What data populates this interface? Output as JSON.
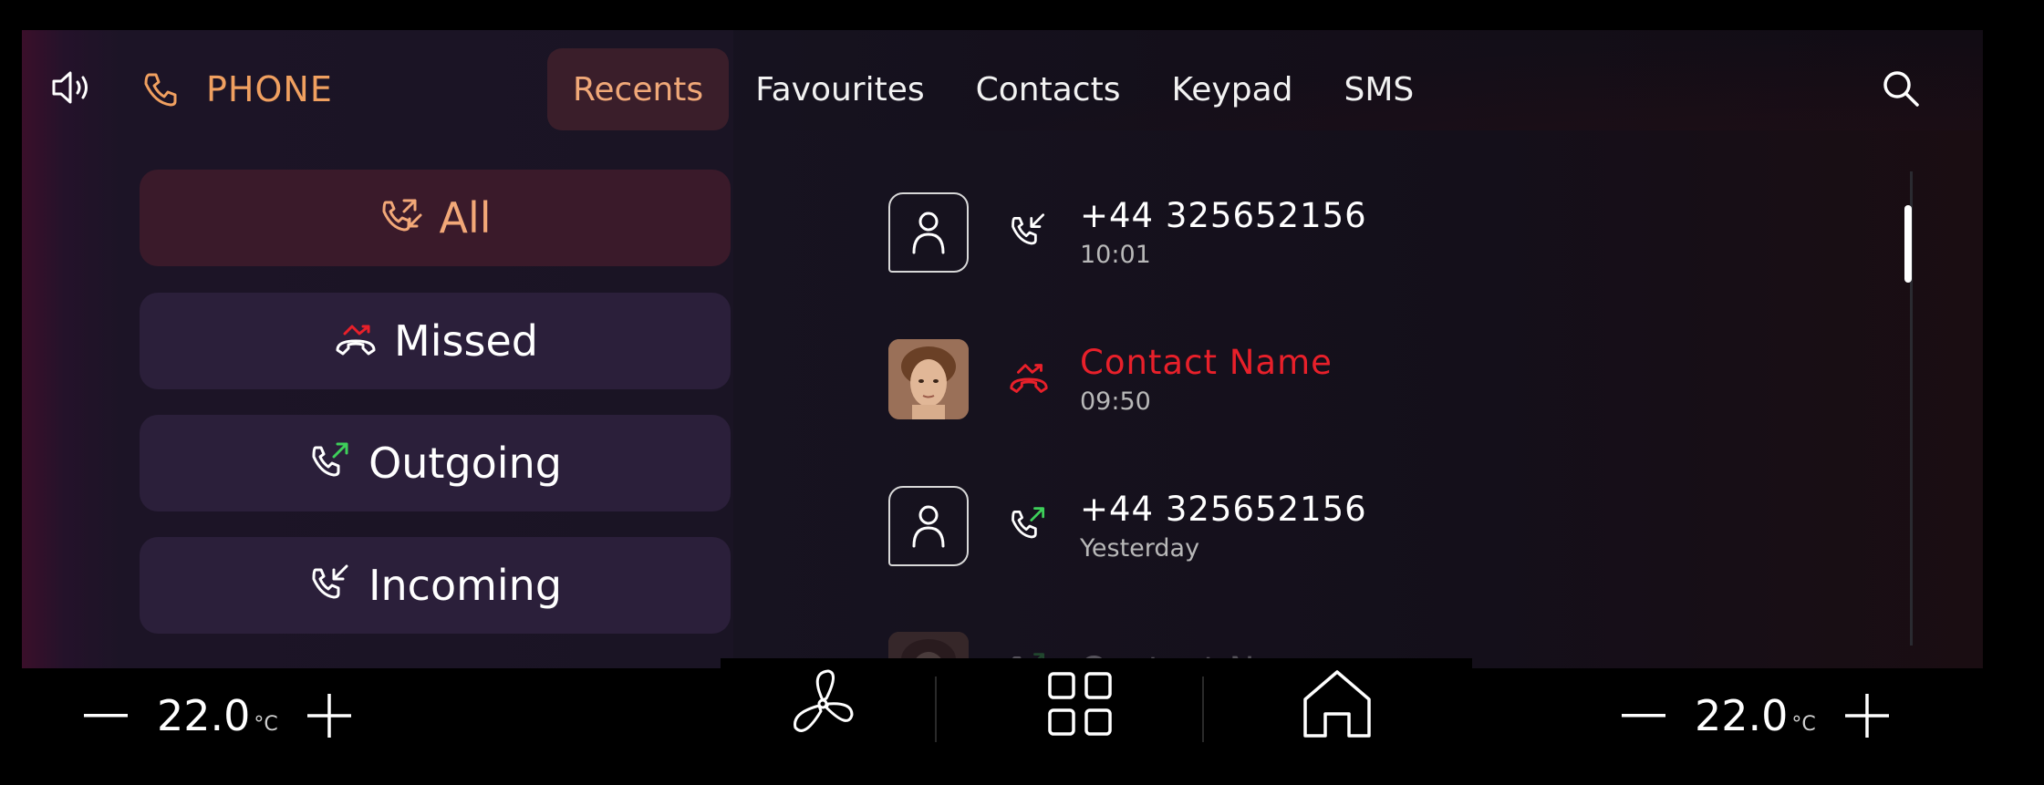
{
  "header": {
    "volume_icon": "speaker-icon",
    "app_icon": "phone-icon",
    "app_title": "PHONE",
    "tabs": [
      {
        "label": "Recents",
        "active": true
      },
      {
        "label": "Favourites",
        "active": false
      },
      {
        "label": "Contacts",
        "active": false
      },
      {
        "label": "Keypad",
        "active": false
      },
      {
        "label": "SMS",
        "active": false
      }
    ],
    "search_icon": "search-icon"
  },
  "filters": [
    {
      "label": "All",
      "icon": "all-calls-icon",
      "active": true
    },
    {
      "label": "Missed",
      "icon": "missed-call-icon",
      "active": false
    },
    {
      "label": "Outgoing",
      "icon": "outgoing-call-icon",
      "active": false
    },
    {
      "label": "Incoming",
      "icon": "incoming-call-icon",
      "active": false
    }
  ],
  "calls": [
    {
      "name": "+44 325652156",
      "time": "10:01",
      "type": "incoming",
      "avatar": "person-icon"
    },
    {
      "name": "Contact Name",
      "time": "09:50",
      "type": "missed",
      "avatar": "photo"
    },
    {
      "name": "+44 325652156",
      "time": "Yesterday",
      "type": "outgoing",
      "avatar": "person-icon"
    },
    {
      "name": "Contact Name",
      "time": "",
      "type": "outgoing",
      "avatar": "photo"
    }
  ],
  "dock": [
    "fan-icon",
    "apps-grid-icon",
    "home-icon"
  ],
  "climate": {
    "left": {
      "value": "22.0",
      "unit": "°C"
    },
    "right": {
      "value": "22.0",
      "unit": "°C"
    }
  },
  "colors": {
    "accent": "#f0a060",
    "missed": "#e8202a",
    "outgoing_arrow": "#3ecf5a",
    "filter_bg": "#2b1f3a"
  }
}
